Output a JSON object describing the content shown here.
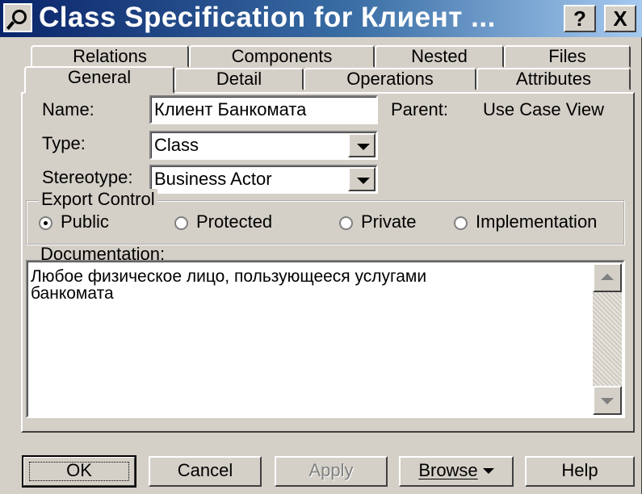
{
  "window": {
    "title": "Class Specification for Клиент ...",
    "help_button": "?",
    "close_button": "X"
  },
  "tabs": {
    "back_row": [
      "Relations",
      "Components",
      "Nested",
      "Files"
    ],
    "front_row": [
      "General",
      "Detail",
      "Operations",
      "Attributes"
    ],
    "active": "General"
  },
  "general": {
    "name_label": "Name:",
    "name_value": "Клиент Банкомата",
    "parent_label": "Parent:",
    "parent_value": "Use Case View",
    "type_label": "Type:",
    "type_value": "Class",
    "stereotype_label": "Stereotype:",
    "stereotype_value": "Business Actor",
    "export_control": {
      "title": "Export Control",
      "options": [
        "Public",
        "Protected",
        "Private",
        "Implementation"
      ],
      "selected": "Public"
    },
    "documentation_label": "Documentation:",
    "documentation_text": "Любое физическое лицо, пользующееся услугами\nбанкомата"
  },
  "buttons": {
    "ok": "OK",
    "cancel": "Cancel",
    "apply": "Apply",
    "browse": "Browse",
    "help": "Help"
  },
  "colors": {
    "title_start": "#0a246a",
    "title_end": "#a6caf0",
    "face": "#d4d0c8"
  }
}
